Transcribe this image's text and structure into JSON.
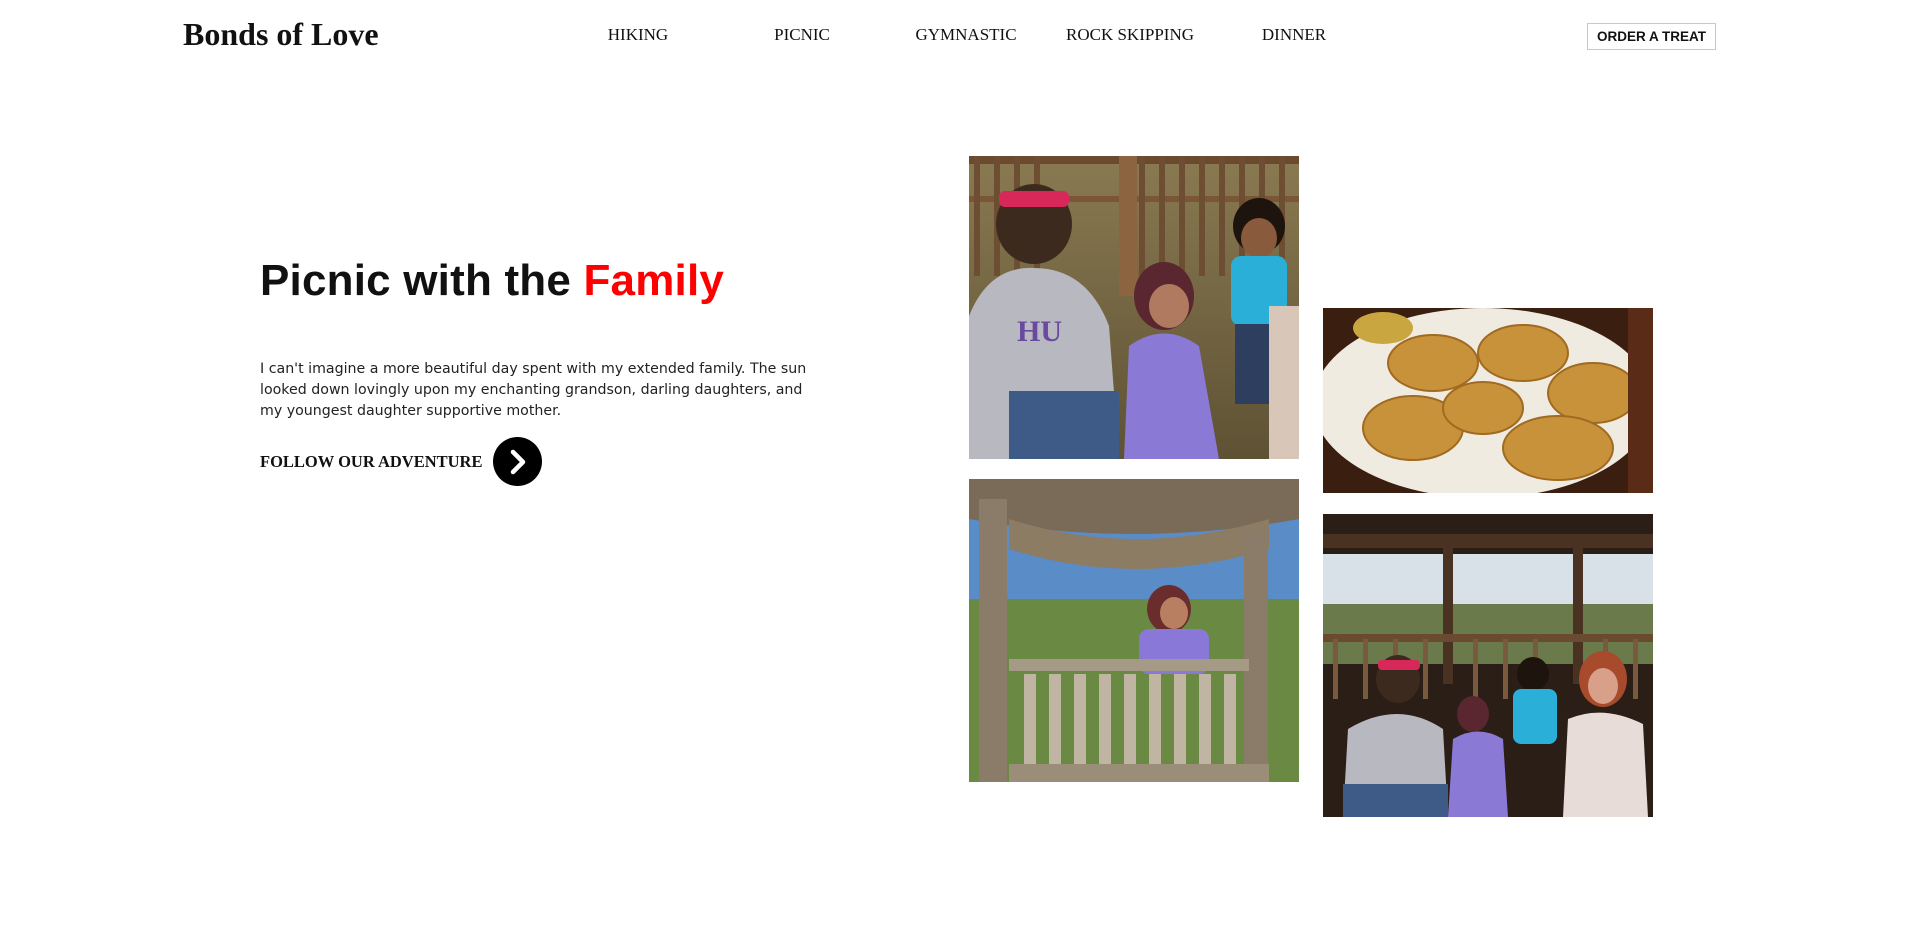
{
  "brand": {
    "name": "Bonds of Love"
  },
  "nav": {
    "items": [
      {
        "label": "HIKING"
      },
      {
        "label": "PICNIC"
      },
      {
        "label": "GYMNASTIC"
      },
      {
        "label": "ROCK SKIPPING"
      },
      {
        "label": "DINNER"
      }
    ]
  },
  "header": {
    "order_label": "ORDER A TREAT"
  },
  "hero": {
    "title_main": "Picnic with the ",
    "title_accent": "Family",
    "accent_color": "#ff0000",
    "body": "I can't imagine a more beautiful day spent with my extended family. The sun looked down lovingly upon my enchanting grandson, darling daughters, and my youngest daughter supportive mother.",
    "cta_label": "FOLLOW OUR ADVENTURE",
    "cta_icon": "chevron-right-icon"
  },
  "gallery": {
    "photos": [
      {
        "subject": "family-on-bench"
      },
      {
        "subject": "pastries-on-plate"
      },
      {
        "subject": "girl-in-gazebo"
      },
      {
        "subject": "family-group-gazebo"
      }
    ]
  }
}
